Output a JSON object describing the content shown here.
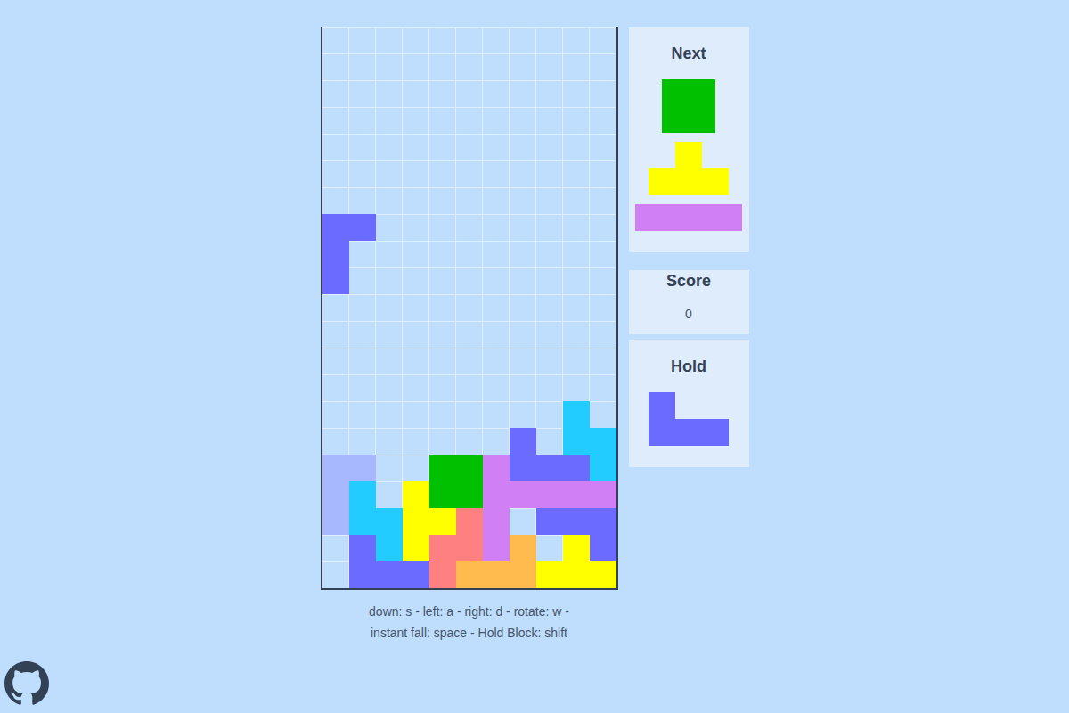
{
  "board": {
    "rows": [
      [
        "",
        "",
        "",
        "",
        "",
        "",
        "",
        "",
        "",
        "",
        ""
      ],
      [
        "",
        "",
        "",
        "",
        "",
        "",
        "",
        "",
        "",
        "",
        ""
      ],
      [
        "",
        "",
        "",
        "",
        "",
        "",
        "",
        "",
        "",
        "",
        ""
      ],
      [
        "",
        "",
        "",
        "",
        "",
        "",
        "",
        "",
        "",
        "",
        ""
      ],
      [
        "",
        "",
        "",
        "",
        "",
        "",
        "",
        "",
        "",
        "",
        ""
      ],
      [
        "",
        "",
        "",
        "",
        "",
        "",
        "",
        "",
        "",
        "",
        ""
      ],
      [
        "",
        "",
        "",
        "",
        "",
        "",
        "",
        "",
        "",
        "",
        ""
      ],
      [
        "#6b6bff",
        "#6b6bff",
        "",
        "",
        "",
        "",
        "",
        "",
        "",
        "",
        ""
      ],
      [
        "#6b6bff",
        "",
        "",
        "",
        "",
        "",
        "",
        "",
        "",
        "",
        ""
      ],
      [
        "#6b6bff",
        "",
        "",
        "",
        "",
        "",
        "",
        "",
        "",
        "",
        ""
      ],
      [
        "",
        "",
        "",
        "",
        "",
        "",
        "",
        "",
        "",
        "",
        ""
      ],
      [
        "",
        "",
        "",
        "",
        "",
        "",
        "",
        "",
        "",
        "",
        ""
      ],
      [
        "",
        "",
        "",
        "",
        "",
        "",
        "",
        "",
        "",
        "",
        ""
      ],
      [
        "",
        "",
        "",
        "",
        "",
        "",
        "",
        "",
        "",
        "",
        ""
      ],
      [
        "",
        "",
        "",
        "",
        "",
        "",
        "",
        "",
        "",
        "#22ccff",
        ""
      ],
      [
        "",
        "",
        "",
        "",
        "",
        "",
        "",
        "#6b6bff",
        "",
        "#22ccff",
        "#22ccff"
      ],
      [
        "#a8b8ff",
        "#a8b8ff",
        "",
        "",
        "#00c000",
        "#00c000",
        "#d17ff5",
        "#6b6bff",
        "#6b6bff",
        "#6b6bff",
        "#22ccff"
      ],
      [
        "#a8b8ff",
        "#22ccff",
        "",
        "#ffff00",
        "#00c000",
        "#00c000",
        "#d17ff5",
        "#d17ff5",
        "#d17ff5",
        "#d17ff5",
        "#d17ff5"
      ],
      [
        "#a8b8ff",
        "#22ccff",
        "#22ccff",
        "#ffff00",
        "#ffff00",
        "#ff8080",
        "#d17ff5",
        "",
        "#6b6bff",
        "#6b6bff",
        "#6b6bff"
      ],
      [
        "",
        "#6b6bff",
        "#22ccff",
        "#ffff00",
        "#ff8080",
        "#ff8080",
        "#d17ff5",
        "#ffbb4d",
        "",
        "#ffff00",
        "#6b6bff"
      ],
      [
        "",
        "#6b6bff",
        "#6b6bff",
        "#6b6bff",
        "#ff8080",
        "#ffbb4d",
        "#ffbb4d",
        "#ffbb4d",
        "#ffff00",
        "#ffff00",
        "#ffff00"
      ]
    ]
  },
  "controls": [
    "down: s - left: a - right: d - rotate: w -",
    "instant fall: space - Hold Block: shift"
  ],
  "next": {
    "title": "Next",
    "pieces": [
      {
        "cells": [
          [
            1,
            1
          ],
          [
            1,
            1
          ]
        ],
        "color": "#00c000"
      },
      {
        "cells": [
          [
            0,
            1,
            0
          ],
          [
            1,
            1,
            1
          ]
        ],
        "color": "#ffff00"
      },
      {
        "cells": [
          [
            1,
            1,
            1,
            1
          ]
        ],
        "color": "#d17ff5"
      }
    ]
  },
  "score": {
    "title": "Score",
    "value": "0"
  },
  "hold": {
    "title": "Hold",
    "piece": {
      "cells": [
        [
          1,
          0,
          0
        ],
        [
          1,
          1,
          1
        ]
      ],
      "color": "#6b6bff"
    }
  }
}
